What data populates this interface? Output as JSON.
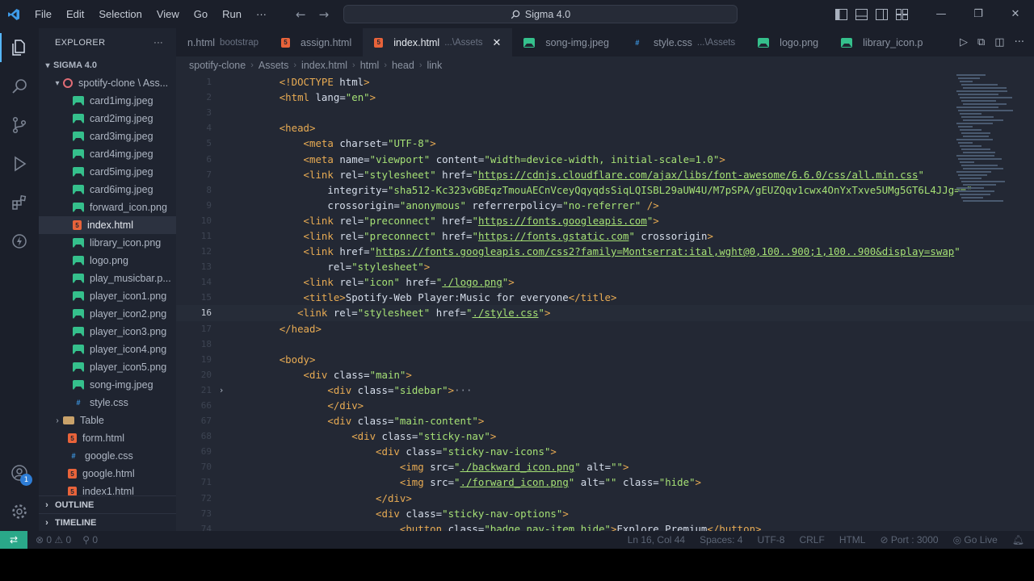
{
  "titlebar": {
    "menu": [
      "File",
      "Edit",
      "Selection",
      "View",
      "Go",
      "Run",
      "···"
    ],
    "search": "Sigma 4.0"
  },
  "sidebar": {
    "title": "EXPLORER",
    "more": "···",
    "root": "SIGMA 4.0",
    "subfolder": "spotify-clone \\ Ass...",
    "files": [
      {
        "name": "card1img.jpeg",
        "type": "img"
      },
      {
        "name": "card2img.jpeg",
        "type": "img"
      },
      {
        "name": "card3img.jpeg",
        "type": "img"
      },
      {
        "name": "card4img.jpeg",
        "type": "img"
      },
      {
        "name": "card5img.jpeg",
        "type": "img"
      },
      {
        "name": "card6img.jpeg",
        "type": "img"
      },
      {
        "name": "forward_icon.png",
        "type": "img"
      },
      {
        "name": "index.html",
        "type": "html",
        "selected": true
      },
      {
        "name": "library_icon.png",
        "type": "img"
      },
      {
        "name": "logo.png",
        "type": "img"
      },
      {
        "name": "play_musicbar.p...",
        "type": "img"
      },
      {
        "name": "player_icon1.png",
        "type": "img"
      },
      {
        "name": "player_icon2.png",
        "type": "img"
      },
      {
        "name": "player_icon3.png",
        "type": "img"
      },
      {
        "name": "player_icon4.png",
        "type": "img"
      },
      {
        "name": "player_icon5.png",
        "type": "img"
      },
      {
        "name": "song-img.jpeg",
        "type": "img"
      },
      {
        "name": "style.css",
        "type": "css"
      }
    ],
    "folder_table": "Table",
    "top_files": [
      {
        "name": "form.html",
        "type": "html"
      },
      {
        "name": "google.css",
        "type": "css"
      },
      {
        "name": "google.html",
        "type": "html"
      },
      {
        "name": "index1.html",
        "type": "html"
      }
    ],
    "outline": "OUTLINE",
    "timeline": "TIMELINE"
  },
  "tabs": [
    {
      "name": "n.html",
      "desc": "bootstrap",
      "type": "html"
    },
    {
      "name": "assign.html",
      "desc": "",
      "type": "html"
    },
    {
      "name": "index.html",
      "desc": "...\\Assets",
      "type": "html",
      "active": true
    },
    {
      "name": "song-img.jpeg",
      "desc": "",
      "type": "img"
    },
    {
      "name": "style.css",
      "desc": "...\\Assets",
      "type": "css"
    },
    {
      "name": "logo.png",
      "desc": "",
      "type": "img"
    },
    {
      "name": "library_icon.p",
      "desc": "",
      "type": "img"
    }
  ],
  "breadcrumb": [
    "spotify-clone",
    "Assets",
    "index.html",
    "html",
    "head",
    "link"
  ],
  "code_lines": [
    {
      "n": "1",
      "html": "<span class='tag'>&lt;!DOCTYPE</span> <span class='attr'>html</span><span class='tag'>&gt;</span>"
    },
    {
      "n": "2",
      "html": "<span class='tag'>&lt;html</span> <span class='attr'>lang</span><span class='plain'>=</span><span class='str'>\"en\"</span><span class='tag'>&gt;</span>"
    },
    {
      "n": "3",
      "html": ""
    },
    {
      "n": "4",
      "html": "<span class='tag'>&lt;head&gt;</span>"
    },
    {
      "n": "5",
      "html": "    <span class='tag'>&lt;meta</span> <span class='attr'>charset</span><span class='plain'>=</span><span class='str'>\"UTF-8\"</span><span class='tag'>&gt;</span>"
    },
    {
      "n": "6",
      "html": "    <span class='tag'>&lt;meta</span> <span class='attr'>name</span><span class='plain'>=</span><span class='str'>\"viewport\"</span> <span class='attr'>content</span><span class='plain'>=</span><span class='str'>\"width=device-width, initial-scale=1.0\"</span><span class='tag'>&gt;</span>"
    },
    {
      "n": "7",
      "html": "    <span class='tag'>&lt;link</span> <span class='attr'>rel</span><span class='plain'>=</span><span class='str'>\"stylesheet\"</span> <span class='attr'>href</span><span class='plain'>=</span><span class='str'>\"</span><span class='url'>https://cdnjs.cloudflare.com/ajax/libs/font-awesome/6.6.0/css/all.min.css</span><span class='str'>\"</span>"
    },
    {
      "n": "8",
      "html": "        <span class='attr'>integrity</span><span class='plain'>=</span><span class='str'>\"sha512-Kc323vGBEqzTmouAECnVceyQqyqdsSiqLQISBL29aUW4U/M7pSPA/gEUZQqv1cwx4OnYxTxve5UMg5GT6L4JJg==\"</span>"
    },
    {
      "n": "9",
      "html": "        <span class='attr'>crossorigin</span><span class='plain'>=</span><span class='str'>\"anonymous\"</span> <span class='attr'>referrerpolicy</span><span class='plain'>=</span><span class='str'>\"no-referrer\"</span> <span class='tag'>/&gt;</span>"
    },
    {
      "n": "10",
      "html": "    <span class='tag'>&lt;link</span> <span class='attr'>rel</span><span class='plain'>=</span><span class='str'>\"preconnect\"</span> <span class='attr'>href</span><span class='plain'>=</span><span class='str'>\"</span><span class='url'>https://fonts.googleapis.com</span><span class='str'>\"</span><span class='tag'>&gt;</span>"
    },
    {
      "n": "11",
      "html": "    <span class='tag'>&lt;link</span> <span class='attr'>rel</span><span class='plain'>=</span><span class='str'>\"preconnect\"</span> <span class='attr'>href</span><span class='plain'>=</span><span class='str'>\"</span><span class='url'>https://fonts.gstatic.com</span><span class='str'>\"</span> <span class='attr'>crossorigin</span><span class='tag'>&gt;</span>"
    },
    {
      "n": "12",
      "html": "    <span class='tag'>&lt;link</span> <span class='attr'>href</span><span class='plain'>=</span><span class='str'>\"</span><span class='url'>https://fonts.googleapis.com/css2?family=Montserrat:ital,wght@0,100..900;1,100..900&amp;display=swap</span><span class='str'>\"</span>"
    },
    {
      "n": "13",
      "html": "        <span class='attr'>rel</span><span class='plain'>=</span><span class='str'>\"stylesheet\"</span><span class='tag'>&gt;</span>"
    },
    {
      "n": "14",
      "html": "    <span class='tag'>&lt;link</span> <span class='attr'>rel</span><span class='plain'>=</span><span class='str'>\"icon\"</span> <span class='attr'>href</span><span class='plain'>=</span><span class='str'>\"</span><span class='url'>./logo.png</span><span class='str'>\"</span><span class='tag'>&gt;</span>"
    },
    {
      "n": "15",
      "html": "    <span class='tag'>&lt;title&gt;</span><span class='plain'>Spotify-Web Player:Music for everyone</span><span class='tag'>&lt;/title&gt;</span>"
    },
    {
      "n": "16",
      "html": "   <span class='tag'>&lt;link</span> <span class='attr'>rel</span><span class='plain'>=</span><span class='str'>\"stylesheet\"</span> <span class='attr'>href</span><span class='plain'>=</span><span class='str'>\"</span><span class='url'>./style.css</span><span class='str'>\"</span><span class='tag'>&gt;</span>",
      "current": true
    },
    {
      "n": "17",
      "html": "<span class='tag'>&lt;/head&gt;</span>"
    },
    {
      "n": "18",
      "html": ""
    },
    {
      "n": "19",
      "html": "<span class='tag'>&lt;body&gt;</span>"
    },
    {
      "n": "20",
      "html": "    <span class='tag'>&lt;div</span> <span class='attr'>class</span><span class='plain'>=</span><span class='str'>\"main\"</span><span class='tag'>&gt;</span>"
    },
    {
      "n": "21",
      "html": "        <span class='tag'>&lt;div</span> <span class='attr'>class</span><span class='plain'>=</span><span class='str'>\"sidebar\"</span><span class='tag'>&gt;</span><span class='ell'>···</span>",
      "fold": "›"
    },
    {
      "n": "66",
      "html": "        <span class='tag'>&lt;/div&gt;</span>"
    },
    {
      "n": "67",
      "html": "        <span class='tag'>&lt;div</span> <span class='attr'>class</span><span class='plain'>=</span><span class='str'>\"main-content\"</span><span class='tag'>&gt;</span>"
    },
    {
      "n": "68",
      "html": "            <span class='tag'>&lt;div</span> <span class='attr'>class</span><span class='plain'>=</span><span class='str'>\"sticky-nav\"</span><span class='tag'>&gt;</span>"
    },
    {
      "n": "69",
      "html": "                <span class='tag'>&lt;div</span> <span class='attr'>class</span><span class='plain'>=</span><span class='str'>\"sticky-nav-icons\"</span><span class='tag'>&gt;</span>"
    },
    {
      "n": "70",
      "html": "                    <span class='tag'>&lt;img</span> <span class='attr'>src</span><span class='plain'>=</span><span class='str'>\"</span><span class='url'>./backward_icon.png</span><span class='str'>\"</span> <span class='attr'>alt</span><span class='plain'>=</span><span class='str'>\"\"</span><span class='tag'>&gt;</span>"
    },
    {
      "n": "71",
      "html": "                    <span class='tag'>&lt;img</span> <span class='attr'>src</span><span class='plain'>=</span><span class='str'>\"</span><span class='url'>./forward_icon.png</span><span class='str'>\"</span> <span class='attr'>alt</span><span class='plain'>=</span><span class='str'>\"\"</span> <span class='attr'>class</span><span class='plain'>=</span><span class='str'>\"hide\"</span><span class='tag'>&gt;</span>"
    },
    {
      "n": "72",
      "html": "                <span class='tag'>&lt;/div&gt;</span>"
    },
    {
      "n": "73",
      "html": "                <span class='tag'>&lt;div</span> <span class='attr'>class</span><span class='plain'>=</span><span class='str'>\"sticky-nav-options\"</span><span class='tag'>&gt;</span>"
    },
    {
      "n": "74",
      "html": "                    <span class='tag'>&lt;button</span> <span class='attr'>class</span><span class='plain'>=</span><span class='str'>\"badge nav-item hide\"</span><span class='tag'>&gt;</span><span class='plain'>Explore Premium</span><span class='tag'>&lt;/button&gt;</span>"
    }
  ],
  "statusbar": {
    "errors": "0",
    "warnings": "0",
    "ports": "0",
    "position": "Ln 16, Col 44",
    "spaces": "Spaces: 4",
    "encoding": "UTF-8",
    "eol": "CRLF",
    "language": "HTML",
    "port": "Port : 3000",
    "golive": "Go Live"
  },
  "activity_badge": "1",
  "colors": {
    "accent": "#56b6ff",
    "remote": "#2aa889",
    "tag": "#e8ab53",
    "string": "#a5e075"
  }
}
